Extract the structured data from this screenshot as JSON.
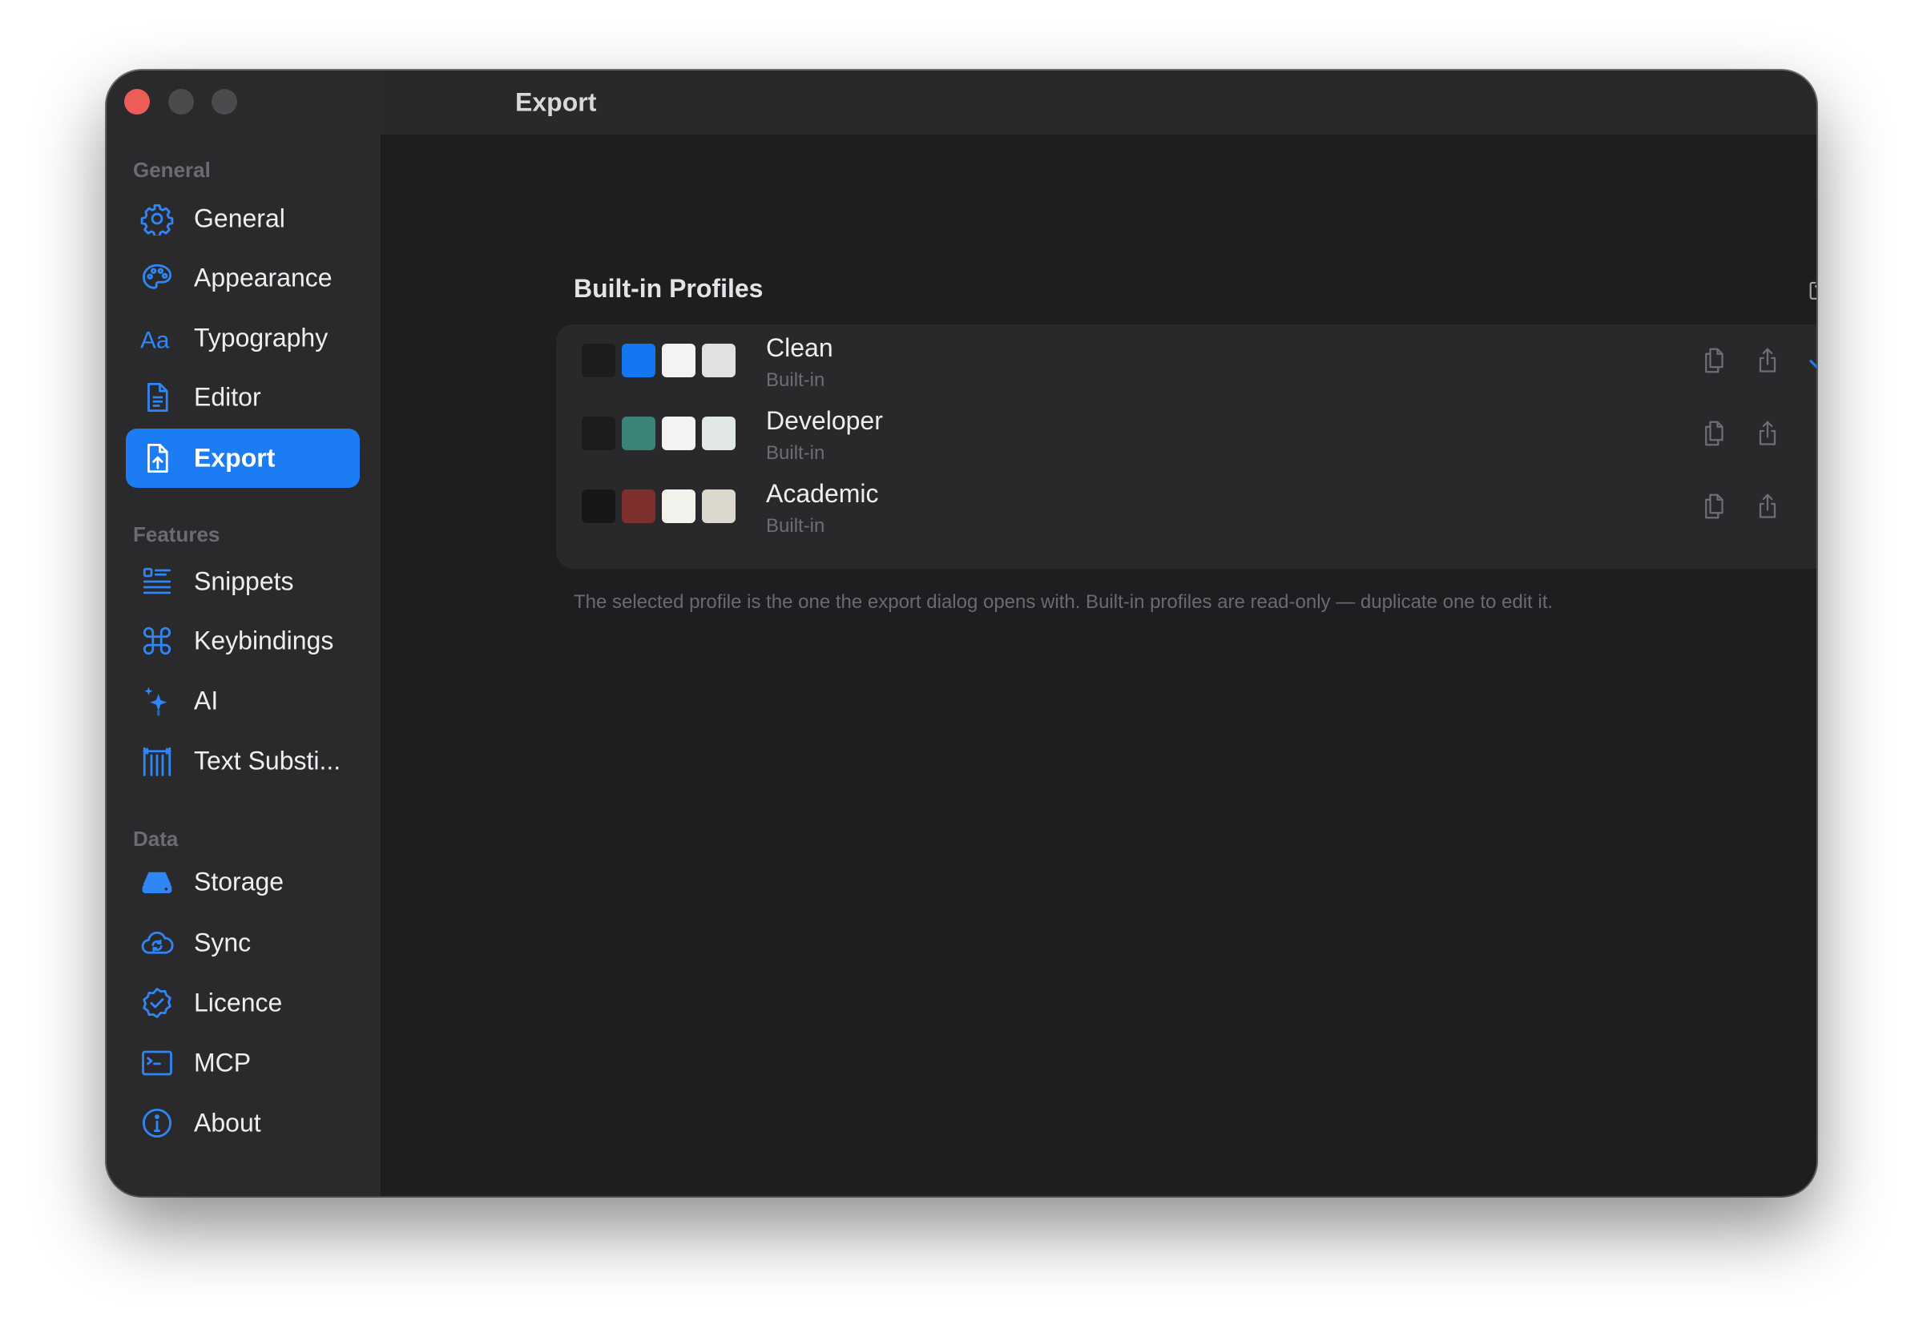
{
  "window": {
    "title": "Export"
  },
  "sidebar": {
    "groups": [
      {
        "header": "General",
        "items": [
          {
            "label": "General",
            "icon": "gear-icon"
          },
          {
            "label": "Appearance",
            "icon": "palette-icon"
          },
          {
            "label": "Typography",
            "icon": "typography-icon"
          },
          {
            "label": "Editor",
            "icon": "document-icon"
          },
          {
            "label": "Export",
            "icon": "export-document-icon",
            "selected": true
          }
        ]
      },
      {
        "header": "Features",
        "items": [
          {
            "label": "Snippets",
            "icon": "snippets-list-icon"
          },
          {
            "label": "Keybindings",
            "icon": "command-key-icon"
          },
          {
            "label": "AI",
            "icon": "sparkles-icon"
          },
          {
            "label": "Text Substi...",
            "icon": "text-substitution-icon"
          }
        ]
      },
      {
        "header": "Data",
        "items": [
          {
            "label": "Storage",
            "icon": "storage-drive-icon"
          },
          {
            "label": "Sync",
            "icon": "sync-cloud-icon"
          },
          {
            "label": "Licence",
            "icon": "licence-seal-icon"
          },
          {
            "label": "MCP",
            "icon": "terminal-icon"
          },
          {
            "label": "About",
            "icon": "info-icon"
          }
        ]
      }
    ]
  },
  "main": {
    "section_title": "Built-in Profiles",
    "import_icon": "import-icon",
    "profiles": [
      {
        "name": "Clean",
        "subtitle": "Built-in",
        "swatches": [
          "#1c1c1e",
          "#1477f2",
          "#f3f3f3",
          "#e1e1e1"
        ],
        "selected": true
      },
      {
        "name": "Developer",
        "subtitle": "Built-in",
        "swatches": [
          "#1c1c1e",
          "#3a8379",
          "#f3f3f3",
          "#e1e6e6"
        ],
        "selected": false
      },
      {
        "name": "Academic",
        "subtitle": "Built-in",
        "swatches": [
          "#161616",
          "#7e2e2b",
          "#f2f1ec",
          "#dcd8cd"
        ],
        "selected": false
      }
    ],
    "help_text": "The selected profile is the one the export dialog opens with. Built-in profiles are read-only — duplicate one to edit it."
  },
  "colors": {
    "accent": "#1b7cf4",
    "icon_blue": "#2f86f6",
    "window_bg": "#1e1e20",
    "sidebar_bg": "#2a2a2d",
    "card_bg": "#29292b"
  }
}
